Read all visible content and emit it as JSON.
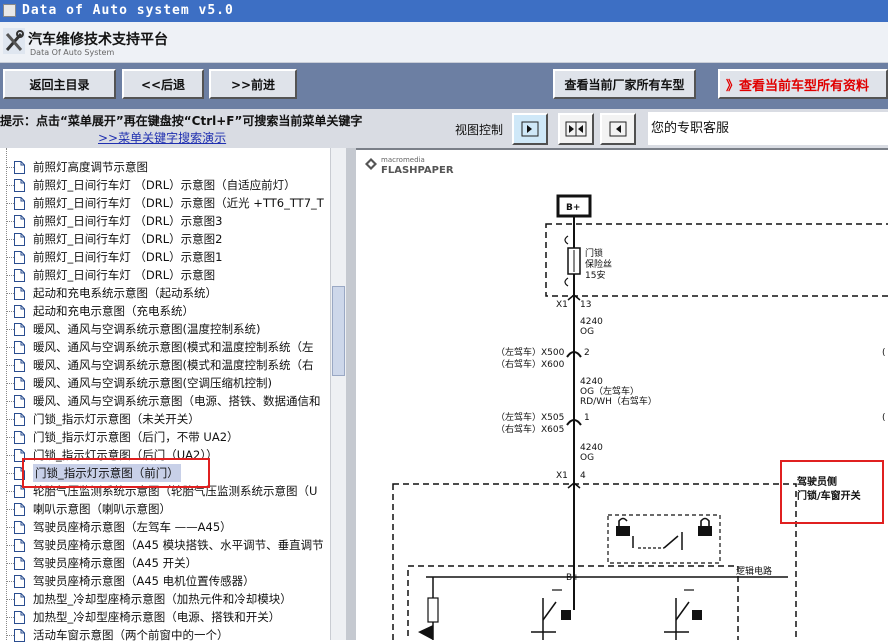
{
  "window": {
    "title": "Data of Auto system v5.0"
  },
  "brand": {
    "name_cn": "汽车维修技术支持平台",
    "name_en": "Data Of Auto System"
  },
  "nav": {
    "home": "返回主目录",
    "back": "<<后退",
    "forward": ">>前进",
    "all_manufacturer_models": "查看当前厂家所有车型",
    "all_model_data": "》查看当前车型所有资料"
  },
  "hint": {
    "text": "提示：点击“菜单展开”再在键盘按“Ctrl+F”可搜索当前菜单关键字",
    "link": ">>菜单关键字搜索演示"
  },
  "view": {
    "label": "视图控制",
    "service": "您的专职客服"
  },
  "tree": {
    "items": [
      {
        "label": "前照灯高度调节示意图"
      },
      {
        "label": "前照灯_日间行车灯 （DRL）示意图（自适应前灯）"
      },
      {
        "label": "前照灯_日间行车灯 （DRL）示意图（近光 +TT6_TT7_T"
      },
      {
        "label": "前照灯_日间行车灯 （DRL）示意图3"
      },
      {
        "label": "前照灯_日间行车灯 （DRL）示意图2"
      },
      {
        "label": "前照灯_日间行车灯 （DRL）示意图1"
      },
      {
        "label": "前照灯_日间行车灯 （DRL）示意图"
      },
      {
        "label": "起动和充电系统示意图（起动系统）"
      },
      {
        "label": "起动和充电示意图（充电系统）"
      },
      {
        "label": "暖风、通风与空调系统示意图(温度控制系统)"
      },
      {
        "label": "暖风、通风与空调系统示意图(模式和温度控制系统（左"
      },
      {
        "label": "暖风、通风与空调系统示意图(模式和温度控制系统（右"
      },
      {
        "label": "暖风、通风与空调系统示意图(空调压缩机控制)"
      },
      {
        "label": "暖风、通风与空调系统示意图（电源、搭铁、数据通信和"
      },
      {
        "label": "门锁_指示灯示意图（未关开关）"
      },
      {
        "label": "门锁_指示灯示意图（后门，不带 UA2）"
      },
      {
        "label": "门锁_指示灯示意图（后门（UA2））"
      },
      {
        "label": "门锁_指示灯示意图（前门）"
      },
      {
        "label": "轮胎气压监测系统示意图（轮胎气压监测系统示意图（U"
      },
      {
        "label": "喇叭示意图（喇叭示意图）"
      },
      {
        "label": "驾驶员座椅示意图（左驾车 ——A45）"
      },
      {
        "label": "驾驶员座椅示意图（A45 模块搭铁、水平调节、垂直调节"
      },
      {
        "label": "驾驶员座椅示意图（A45 开关）"
      },
      {
        "label": "驾驶员座椅示意图（A45 电机位置传感器）"
      },
      {
        "label": "加热型_冷却型座椅示意图（加热元件和冷却模块）"
      },
      {
        "label": "加热型_冷却型座椅示意图（电源、搭铁和开关）"
      },
      {
        "label": "活动车窗示意图（两个前窗中的一个）"
      }
    ]
  },
  "viewer": {
    "brand_small": "macromedia",
    "brand": "FLASHPAPER"
  },
  "diagram": {
    "bplus": "B+",
    "fuse_1": "门锁",
    "fuse_2": "保险丝",
    "fuse_3": "15安",
    "x1_a": "X1",
    "pin_13": "13",
    "w1_num": "4240",
    "w1_col": "OG",
    "c1_left": "（左驾车）X500",
    "c1_right": "（右驾车）X600",
    "pin_2": "2",
    "w2_num": "4240",
    "w2_col_left": "OG（左驾车）",
    "w2_col_right": "RD/WH（右驾车）",
    "c2_left": "（左驾车）X505",
    "c2_right": "（右驾车）X605",
    "pin_1": "1",
    "w3_num": "4240",
    "w3_col": "OG",
    "x1_b": "X1",
    "pin_4": "4",
    "module_bplus": "B+",
    "logic": "逻辑电路",
    "switch_title_1": "驾驶员侧",
    "switch_title_2": "门锁/车窗开关"
  }
}
